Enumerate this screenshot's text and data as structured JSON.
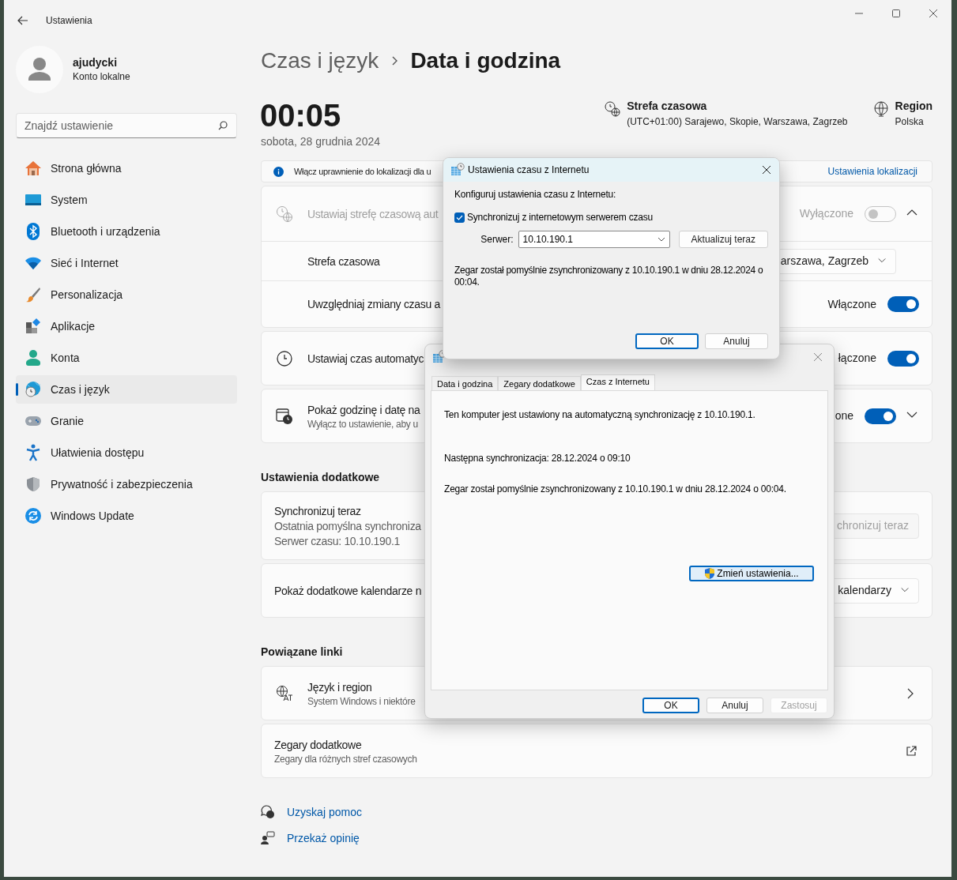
{
  "window": {
    "title": "Ustawienia"
  },
  "user": {
    "name": "ajudycki",
    "account": "Konto lokalne"
  },
  "search": {
    "placeholder": "Znajdź ustawienie"
  },
  "sidebar": {
    "items": [
      {
        "label": "Strona główna",
        "selected": false
      },
      {
        "label": "System",
        "selected": false
      },
      {
        "label": "Bluetooth i urządzenia",
        "selected": false
      },
      {
        "label": "Sieć i Internet",
        "selected": false
      },
      {
        "label": "Personalizacja",
        "selected": false
      },
      {
        "label": "Aplikacje",
        "selected": false
      },
      {
        "label": "Konta",
        "selected": false
      },
      {
        "label": "Czas i język",
        "selected": true
      },
      {
        "label": "Granie",
        "selected": false
      },
      {
        "label": "Ułatwienia dostępu",
        "selected": false
      },
      {
        "label": "Prywatność i zabezpieczenia",
        "selected": false
      },
      {
        "label": "Windows Update",
        "selected": false
      }
    ]
  },
  "breadcrumb": {
    "parent": "Czas i język",
    "current": "Data i godzina"
  },
  "clock": {
    "time": "00:05",
    "date": "sobota, 28 grudnia 2024"
  },
  "timezone": {
    "title": "Strefa czasowa",
    "value": "(UTC+01:00) Sarajewo, Skopie, Warszawa, Zagrzeb"
  },
  "region": {
    "title": "Region",
    "value": "Polska"
  },
  "info_bar": {
    "text": "Włącz uprawnienie do lokalizacji dla u",
    "link": "Ustawienia lokalizacji"
  },
  "sections": [
    {
      "cards": [
        {
          "rows": [
            {
              "kind": "toggle",
              "title": "Ustawiaj strefę czasową aut",
              "disabled": true,
              "state_label": "Wyłączone",
              "on": false,
              "expanded": true
            },
            {
              "kind": "dropdown",
              "title": "Strefa czasowa",
              "value": "arszawa, Zagrzeb"
            },
            {
              "kind": "toggle",
              "title": "Uwzględniaj zmiany czasu a",
              "disabled": false,
              "state_label": "Włączone",
              "on": true
            }
          ]
        },
        {
          "rows": [
            {
              "kind": "toggle",
              "title": "Ustawiaj czas automatyc",
              "disabled": false,
              "state_label": "łączone",
              "on": true
            }
          ]
        },
        {
          "rows": [
            {
              "kind": "toggle",
              "title": "Pokaż godzinę i datę na",
              "subtitle": "Wyłącz to ustawienie, aby u",
              "disabled": false,
              "state_label": "one",
              "on": true,
              "expanded": false
            }
          ]
        }
      ]
    },
    {
      "heading": "Ustawienia dodatkowe",
      "cards": [
        {
          "rows": [
            {
              "kind": "button",
              "title": "Synchronizuj teraz",
              "lines": [
                "Ostatnia pomyślna synchroniza",
                "Serwer czasu: 10.10.190.1"
              ],
              "button": "chronizuj teraz",
              "button_disabled": true
            }
          ]
        },
        {
          "rows": [
            {
              "kind": "dropdown",
              "title": "Pokaż dodatkowe kalendarze n",
              "value": "kalendarzy"
            }
          ]
        }
      ]
    },
    {
      "heading": "Powiązane linki",
      "cards": [
        {
          "rows": [
            {
              "kind": "link",
              "title": "Język i region",
              "subtitle": "System Windows i niektóre"
            }
          ]
        },
        {
          "rows": [
            {
              "kind": "external",
              "title": "Zegary dodatkowe",
              "subtitle": "Zegary dla różnych stref czasowych"
            }
          ]
        }
      ]
    }
  ],
  "help_links": [
    "Uzyskaj pomoc",
    "Przekaż opinię"
  ],
  "date_time_dialog": {
    "tabs": [
      {
        "label": "Data i godzina",
        "selected": false
      },
      {
        "label": "Zegary dodatkowe",
        "selected": false
      },
      {
        "label": "Czas z Internetu",
        "selected": true
      }
    ],
    "lines": [
      "Ten komputer jest ustawiony na automatyczną synchronizację z 10.10.190.1.",
      "Następna synchronizacja: 28.12.2024 o 09:10",
      "Zegar został pomyślnie zsynchronizowany z 10.10.190.1 w dniu 28.12.2024 o 00:04."
    ],
    "change_button": "Zmień ustawienia...",
    "buttons": [
      {
        "label": "OK",
        "default": true,
        "disabled": false
      },
      {
        "label": "Anuluj",
        "default": false,
        "disabled": false
      },
      {
        "label": "Zastosuj",
        "default": false,
        "disabled": true
      }
    ]
  },
  "internet_time_dialog": {
    "title": "Ustawienia czasu z Internetu",
    "heading": "Konfiguruj ustawienia czasu z Internetu:",
    "sync_checkbox": {
      "label": "Synchronizuj z internetowym serwerem czasu",
      "checked": true
    },
    "server_label": "Serwer:",
    "server": "10.10.190.1",
    "update_button": "Aktualizuj teraz",
    "status": "Zegar został pomyślnie zsynchronizowany z 10.10.190.1 w dniu 28.12.2024 o 00:04.",
    "buttons": [
      {
        "label": "OK",
        "default": true
      },
      {
        "label": "Anuluj",
        "default": false
      }
    ]
  }
}
